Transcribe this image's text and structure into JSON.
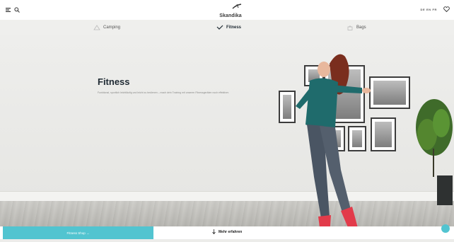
{
  "header": {
    "logo_text": "Skandika",
    "languages": "DE EN FR"
  },
  "categories": [
    {
      "label": "Camping",
      "icon": "tent-icon",
      "active": false
    },
    {
      "label": "Fitness",
      "icon": "fitness-icon",
      "active": true
    },
    {
      "label": "Bags",
      "icon": "bag-icon",
      "active": false
    }
  ],
  "hero": {
    "title": "Fitness",
    "description": "Funktional, sportlich leichtläufig und leicht zu bedienen – mach dein Training mit unseren Fitnessgeräten noch effektiver."
  },
  "footer": {
    "cta_label": "Fitness Shop →",
    "more_label": "Mehr erfahren"
  },
  "colors": {
    "accent": "#52c4d0",
    "text_dark": "#1f2a33"
  }
}
